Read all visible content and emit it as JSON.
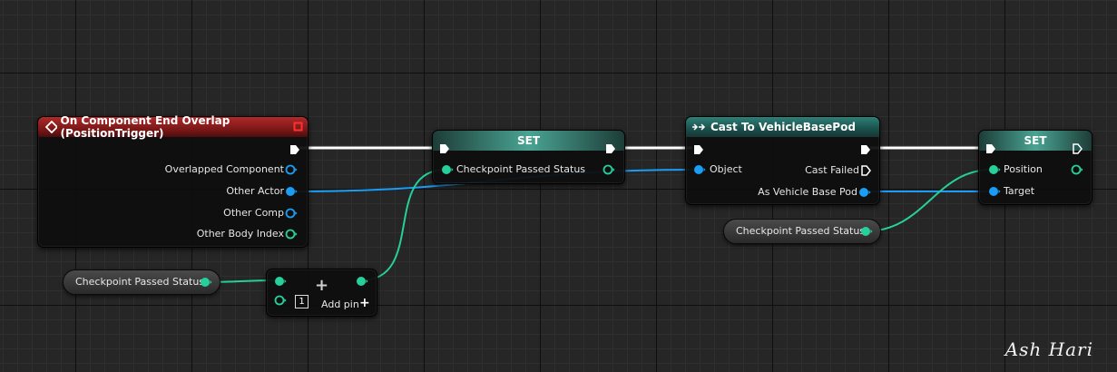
{
  "event_node": {
    "title": "On Component End Overlap (PositionTrigger)",
    "pins": [
      "Overlapped Component",
      "Other Actor",
      "Other Comp",
      "Other Body Index"
    ]
  },
  "set_node_1": {
    "title": "SET",
    "input_label": "Checkpoint Passed Status"
  },
  "cast_node": {
    "title": "Cast To VehicleBasePod",
    "object_label": "Object",
    "cast_failed_label": "Cast Failed",
    "output_label": "As Vehicle Base Pod"
  },
  "set_node_2": {
    "title": "SET",
    "position_label": "Position",
    "target_label": "Target"
  },
  "getter_left": {
    "label": "Checkpoint Passed Status"
  },
  "getter_right": {
    "label": "Checkpoint Passed Status"
  },
  "boolean_node": {
    "add_pin_label": "Add pin",
    "add_box": "1",
    "plus": "+"
  },
  "signature": "Ash Hari",
  "colors": {
    "exec_wire": "#ffffff",
    "object_pin": "#1a9df2",
    "bool_pin": "#27cf9a",
    "event_header": "#a01d1d",
    "set_header": "#3b8c7f",
    "cast_header": "#256b65"
  }
}
